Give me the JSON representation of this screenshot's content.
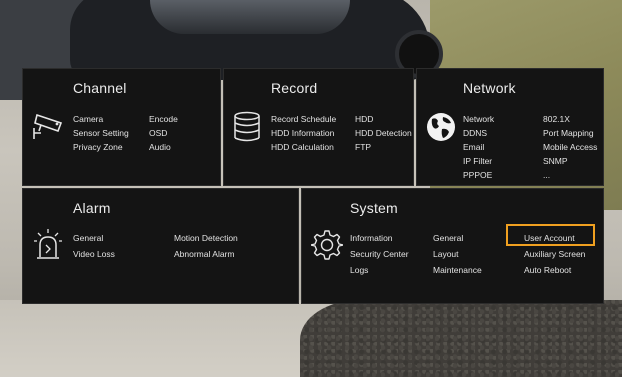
{
  "channel": {
    "title": "Channel",
    "items": [
      "Camera",
      "Sensor Setting",
      "Privacy Zone",
      "Encode",
      "OSD",
      "Audio"
    ]
  },
  "record": {
    "title": "Record",
    "items": [
      "Record Schedule",
      "HDD Information",
      "HDD Calculation",
      "HDD",
      "HDD Detection",
      "FTP"
    ]
  },
  "network": {
    "title": "Network",
    "items": [
      "Network",
      "DDNS",
      "Email",
      "IP Filter",
      "PPPOE",
      "802.1X",
      "Port Mapping",
      "Mobile Access",
      "SNMP",
      "..."
    ]
  },
  "alarm": {
    "title": "Alarm",
    "items": [
      "General",
      "Video Loss",
      "Motion Detection",
      "Abnormal Alarm"
    ]
  },
  "system": {
    "title": "System",
    "items": [
      "Information",
      "Security Center",
      "Logs",
      "General",
      "Layout",
      "Maintenance",
      "User Account",
      "Auxiliary Screen",
      "Auto Reboot"
    ]
  },
  "colors": {
    "highlight": "#f0a020",
    "tile_bg": "#141414",
    "text": "#e2e2e2"
  }
}
